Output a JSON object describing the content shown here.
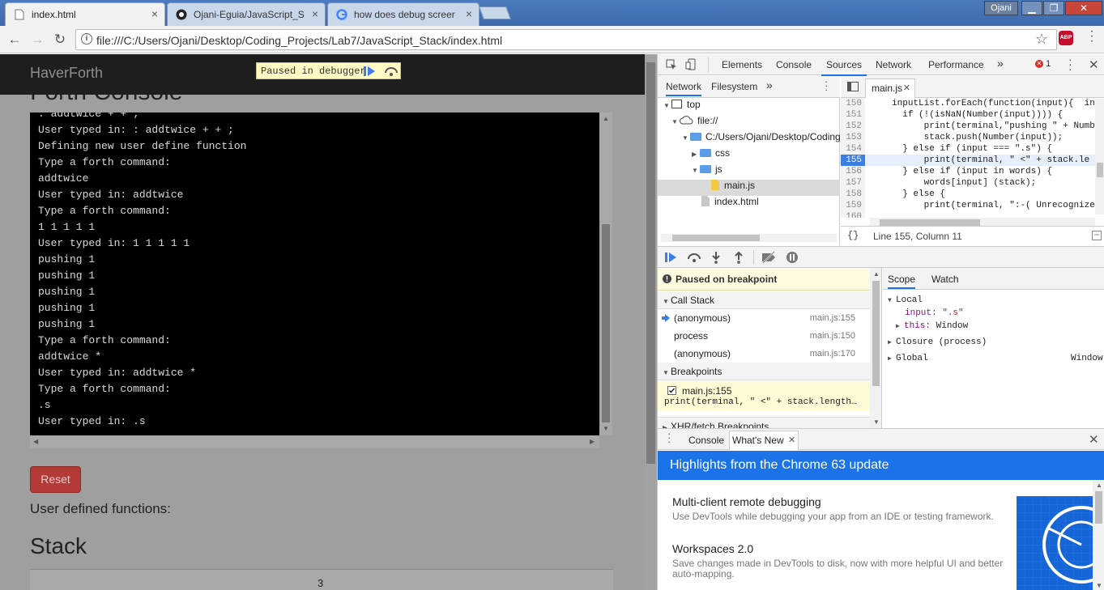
{
  "browser": {
    "tabs": [
      {
        "title": "index.html",
        "active": true
      },
      {
        "title": "Ojani-Eguia/JavaScript_S",
        "active": false
      },
      {
        "title": "how does debug screen",
        "active": false
      }
    ],
    "user": "Ojani",
    "url": "file:///C:/Users/Ojani/Desktop/Coding_Projects/Lab7/JavaScript_Stack/index.html",
    "extension": "ABP"
  },
  "page": {
    "brand": "HaverForth",
    "paused_label": "Paused in debugger",
    "console_heading": "Forth Console",
    "terminal_lines": [
      ": addtwice + + ;",
      "User typed in: : addtwice + + ;",
      "Defining new user define function",
      "Type a forth command:",
      "addtwice",
      "User typed in: addtwice",
      "Type a forth command:",
      "1 1 1 1 1",
      "User typed in: 1 1 1 1 1",
      "pushing 1",
      "pushing 1",
      "pushing 1",
      "pushing 1",
      "pushing 1",
      "Type a forth command:",
      "addtwice *",
      "User typed in: addtwice *",
      "Type a forth command:",
      ".s",
      "User typed in: .s"
    ],
    "reset_label": "Reset",
    "user_defined_label": "User defined functions:",
    "stack_heading": "Stack",
    "stack_value": "3"
  },
  "devtools": {
    "tabs": [
      "Elements",
      "Console",
      "Sources",
      "Network",
      "Performance"
    ],
    "selected_tab": "Sources",
    "more_tabs": "»",
    "error_count": "1",
    "navigator": {
      "tabs": [
        "Network",
        "Filesystem"
      ],
      "more": "»",
      "tree": [
        {
          "label": "top",
          "kind": "frame",
          "depth": 0
        },
        {
          "label": "file://",
          "kind": "cloud",
          "depth": 1
        },
        {
          "label": "C:/Users/Ojani/Desktop/Coding_",
          "kind": "folder",
          "depth": 2
        },
        {
          "label": "css",
          "kind": "folder",
          "depth": 3
        },
        {
          "label": "js",
          "kind": "folder",
          "depth": 3
        },
        {
          "label": "main.js",
          "kind": "js",
          "depth": 4
        },
        {
          "label": "index.html",
          "kind": "html",
          "depth": 3
        }
      ]
    },
    "editor": {
      "file_tab": "main.js",
      "lines": [
        {
          "n": "150",
          "code": "    inputList.forEach(function(input){  in"
        },
        {
          "n": "151",
          "code": "      if (!(isNaN(Number(input)))) {"
        },
        {
          "n": "152",
          "code": "          print(terminal,\"pushing \" + Numb"
        },
        {
          "n": "153",
          "code": "          stack.push(Number(input));"
        },
        {
          "n": "154",
          "code": "      } else if (input === \".s\") {"
        },
        {
          "n": "155",
          "code": "          print(terminal, \" <\" + stack.le"
        },
        {
          "n": "156",
          "code": "      } else if (input in words) {"
        },
        {
          "n": "157",
          "code": "          words[input] (stack);"
        },
        {
          "n": "158",
          "code": "      } else {"
        },
        {
          "n": "159",
          "code": "          print(terminal, \":-( Unrecognize"
        },
        {
          "n": "160",
          "code": ""
        }
      ],
      "breakpoint_line": "155",
      "pretty_print": "{}",
      "cursor_position": "Line 155, Column 11"
    },
    "debugger": {
      "paused_message": "Paused on breakpoint",
      "call_stack_label": "Call Stack",
      "call_stack": [
        {
          "fn": "(anonymous)",
          "loc": "main.js:155",
          "current": true
        },
        {
          "fn": "process",
          "loc": "main.js:150",
          "current": false
        },
        {
          "fn": "(anonymous)",
          "loc": "main.js:170",
          "current": false
        }
      ],
      "breakpoints_label": "Breakpoints",
      "breakpoint": {
        "file": "main.js:155",
        "code": "print(terminal, \" <\" + stack.length…"
      },
      "xhr_label": "XHR/fetch Breakpoints"
    },
    "scope": {
      "tabs": [
        "Scope",
        "Watch"
      ],
      "local_label": "Local",
      "input_key": "input:",
      "input_value": "\".s\"",
      "this_key": "this:",
      "this_value": "Window",
      "closure_label": "Closure (process)",
      "global_label": "Global",
      "global_value": "Window"
    },
    "drawer": {
      "tabs": [
        "Console",
        "What's New"
      ],
      "banner": "Highlights from the Chrome 63 update",
      "items": [
        {
          "title": "Multi-client remote debugging",
          "desc": "Use DevTools while debugging your app from an IDE or testing framework."
        },
        {
          "title": "Workspaces 2.0",
          "desc": "Save changes made in DevTools to disk, now with more helpful UI and better auto-mapping."
        }
      ]
    }
  },
  "colors": {
    "accent": "#1a73e8",
    "breakpoint": "#3d7ee6",
    "reset_button": "#b33a37",
    "terminal_bg": "#000000"
  }
}
